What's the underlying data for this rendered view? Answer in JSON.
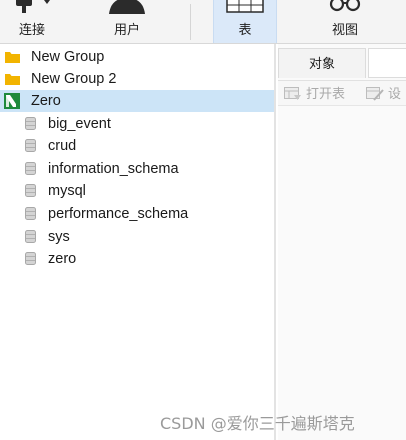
{
  "toolbar": {
    "connect": {
      "label": "连接",
      "icon": "plug-icon"
    },
    "user": {
      "label": "用户",
      "icon": "user-icon"
    },
    "table": {
      "label": "表",
      "icon": "table-icon"
    },
    "view": {
      "label": "视图",
      "icon": "glasses-icon"
    }
  },
  "nav": {
    "items": [
      {
        "label": "New Group",
        "icon": "folder-icon"
      },
      {
        "label": "New Group 2",
        "icon": "folder-icon"
      },
      {
        "label": "Zero",
        "icon": "mysql-connection-icon",
        "selected": true
      },
      {
        "label": "big_event",
        "icon": "database-icon"
      },
      {
        "label": "crud",
        "icon": "database-icon"
      },
      {
        "label": "information_schema",
        "icon": "database-icon"
      },
      {
        "label": "mysql",
        "icon": "database-icon"
      },
      {
        "label": "performance_schema",
        "icon": "database-icon"
      },
      {
        "label": "sys",
        "icon": "database-icon"
      },
      {
        "label": "zero",
        "icon": "database-icon"
      }
    ]
  },
  "objects": {
    "tab_label": "对象",
    "open_table": "打开表",
    "design": "设"
  },
  "watermark": "CSDN @爱你三千遍斯塔克",
  "colors": {
    "selected_row": "#cce4f7",
    "active_toolbar": "#dbe9f9",
    "folder": "#f2b400",
    "connection": "#1f8a3c"
  }
}
